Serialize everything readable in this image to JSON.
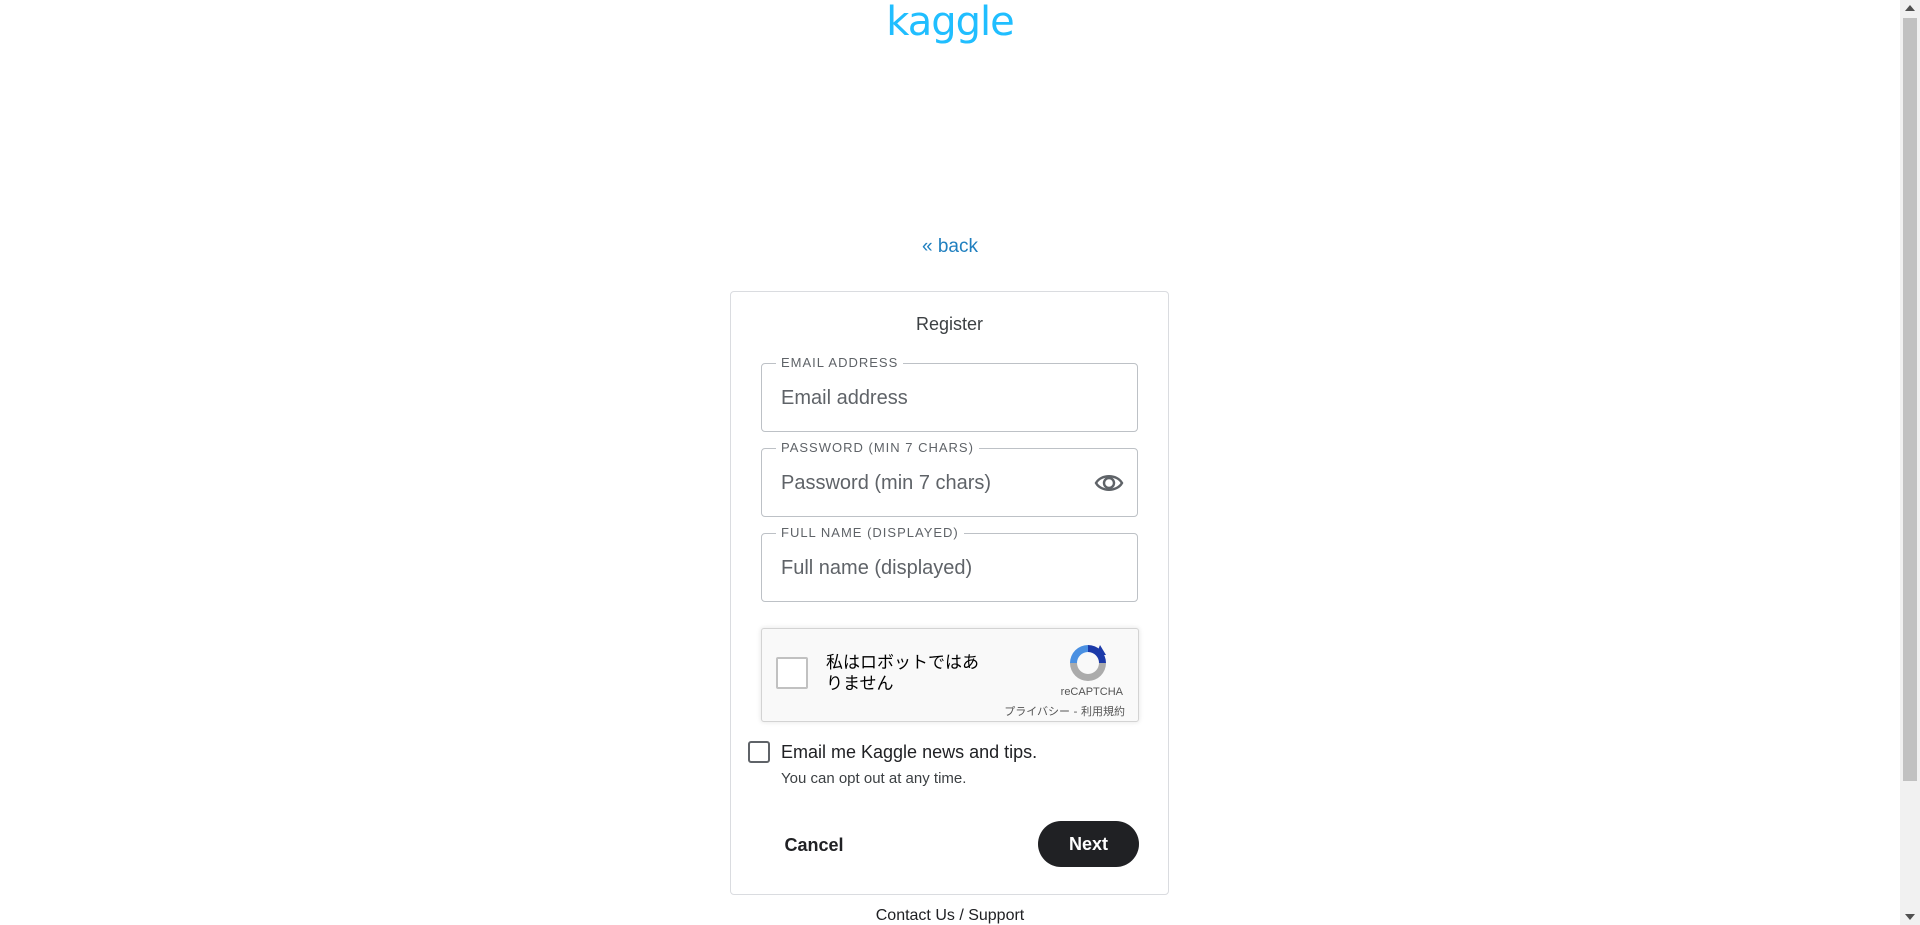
{
  "header": {
    "logo_text": "kaggle",
    "back_link": "« back"
  },
  "register": {
    "title": "Register",
    "email": {
      "label": "EMAIL ADDRESS",
      "placeholder": "Email address",
      "value": ""
    },
    "password": {
      "label": "PASSWORD (MIN 7 CHARS)",
      "placeholder": "Password (min 7 chars)",
      "value": "",
      "toggle_icon": "eye-icon"
    },
    "full_name": {
      "label": "FULL NAME (DISPLAYED)",
      "placeholder": "Full name (displayed)",
      "value": ""
    },
    "recaptcha": {
      "text": "私はロボットではありません",
      "brand": "reCAPTCHA",
      "privacy": "プライバシー",
      "separator": " - ",
      "terms": "利用規約"
    },
    "newsletter": {
      "label": "Email me Kaggle news and tips.",
      "sub": "You can opt out at any time.",
      "checked": false
    },
    "cancel_label": "Cancel",
    "next_label": "Next"
  },
  "footer": {
    "contact_link": "Contact Us / Support"
  },
  "colors": {
    "brand": "#20beff",
    "link": "#1f7fbf",
    "primary_button": "#202124"
  }
}
